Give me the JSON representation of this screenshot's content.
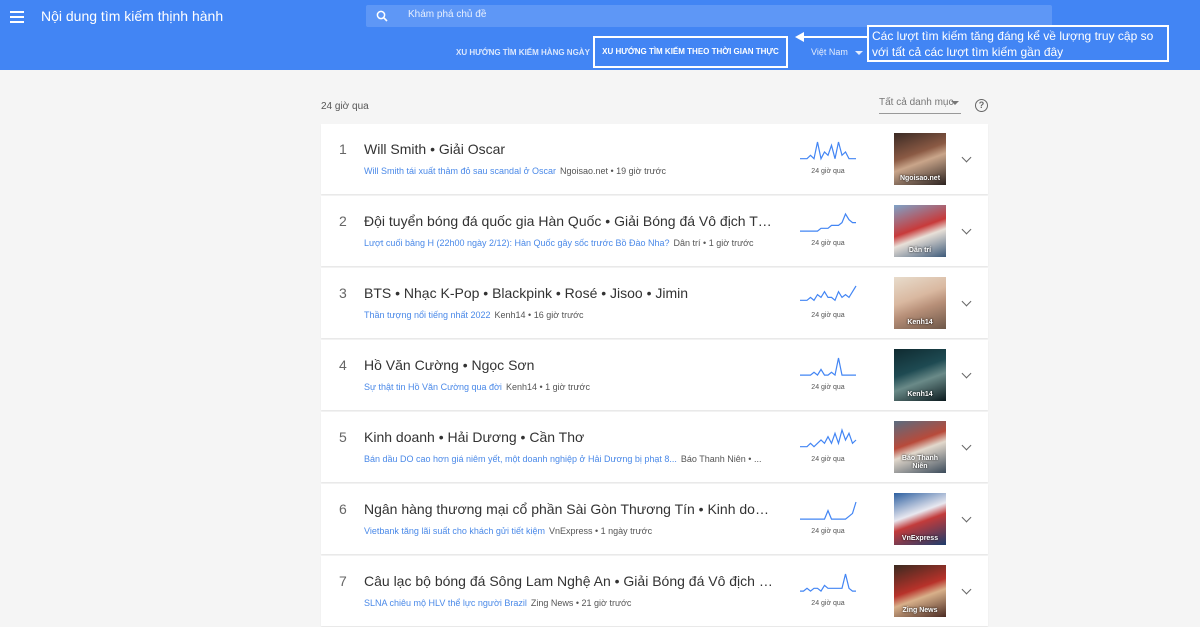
{
  "header": {
    "title": "Nội dung tìm kiếm thịnh hành",
    "search_placeholder": "Khám phá chủ đề",
    "tab_daily": "XU HƯỚNG TÌM KIẾM HÀNG NGÀY",
    "tab_realtime": "XU HƯỚNG TÌM KIẾM THEO THỜI GIAN THỰC",
    "country": "Việt Nam",
    "callout": "Các lượt tìm kiếm tăng đáng kể về lượng truy cập so với tất cả các lượt tìm kiếm gần đây"
  },
  "toolbar": {
    "period": "24 giờ qua",
    "category": "Tất cả danh mục",
    "help": "?"
  },
  "colors": {
    "header_bg": "#4285f4",
    "link": "#4a89e8",
    "spark": "#4285f4"
  },
  "items": [
    {
      "rank": "1",
      "title": "Will Smith • Giải Oscar",
      "link": "Will Smith tái xuất thảm đỏ sau scandal ở Oscar",
      "source": "Ngoisao.net • 19 giờ trước",
      "spark_label": "24 giờ qua",
      "thumb_caption": "Ngoisao.net",
      "spark": [
        1,
        1,
        1,
        2,
        1,
        6,
        1,
        3,
        2,
        5,
        1,
        6,
        2,
        3,
        1,
        1,
        1
      ]
    },
    {
      "rank": "2",
      "title": "Đội tuyển bóng đá quốc gia Hàn Quốc • Giải Bóng đá Vô địch Thế Giới",
      "link": "Lượt cuối bảng H (22h00 ngày 2/12): Hàn Quốc gây sốc trước Bồ Đào Nha?",
      "source": "Dân trí • 1 giờ trước",
      "spark_label": "24 giờ qua",
      "thumb_caption": "Dân trí",
      "spark": [
        1,
        1,
        1,
        1,
        1,
        1,
        2,
        2,
        2,
        3,
        3,
        3,
        4,
        7,
        5,
        4,
        4
      ]
    },
    {
      "rank": "3",
      "title": "BTS • Nhạc K-Pop • Blackpink • Rosé • Jisoo • Jimin",
      "link": "Thần tượng nổi tiếng nhất 2022",
      "source": "Kenh14 • 16 giờ trước",
      "spark_label": "24 giờ qua",
      "thumb_caption": "Kenh14",
      "spark": [
        2,
        2,
        2,
        3,
        2,
        4,
        3,
        5,
        3,
        3,
        2,
        5,
        3,
        4,
        3,
        5,
        7
      ]
    },
    {
      "rank": "4",
      "title": "Hồ Văn Cường • Ngọc Sơn",
      "link": "Sự thật tin Hồ Văn Cường qua đời",
      "source": "Kenh14 • 1 giờ trước",
      "spark_label": "24 giờ qua",
      "thumb_caption": "Kenh14",
      "spark": [
        1,
        1,
        1,
        1,
        2,
        1,
        3,
        1,
        1,
        2,
        1,
        7,
        1,
        1,
        1,
        1,
        1
      ]
    },
    {
      "rank": "5",
      "title": "Kinh doanh • Hải Dương • Cần Thơ",
      "link": "Bán dầu DO cao hơn giá niêm yết, một doanh nghiệp ở Hải Dương bị phạt 8...",
      "source": "Báo Thanh Niên • ...",
      "spark_label": "24 giờ qua",
      "thumb_caption": "Báo Thanh Niên",
      "spark": [
        1,
        1,
        1,
        2,
        1,
        2,
        3,
        2,
        4,
        2,
        5,
        2,
        6,
        3,
        5,
        2,
        3
      ]
    },
    {
      "rank": "6",
      "title": "Ngân hàng thương mại cổ phần Sài Gòn Thương Tín • Kinh doanh",
      "link": "Vietbank tăng lãi suất cho khách gửi tiết kiệm",
      "source": "VnExpress • 1 ngày trước",
      "spark_label": "24 giờ qua",
      "thumb_caption": "VnExpress",
      "spark": [
        1,
        1,
        1,
        1,
        1,
        1,
        1,
        1,
        4,
        1,
        1,
        1,
        1,
        1,
        2,
        3,
        7
      ]
    },
    {
      "rank": "7",
      "title": "Câu lạc bộ bóng đá Sông Lam Nghệ An • Giải Bóng đá Vô địch Quốc gia",
      "link": "SLNA chiêu mộ HLV thể lực người Brazil",
      "source": "Zing News • 21 giờ trước",
      "spark_label": "24 giờ qua",
      "thumb_caption": "Zing News",
      "spark": [
        1,
        1,
        2,
        1,
        2,
        2,
        1,
        3,
        2,
        2,
        2,
        2,
        2,
        7,
        2,
        1,
        1
      ]
    }
  ]
}
